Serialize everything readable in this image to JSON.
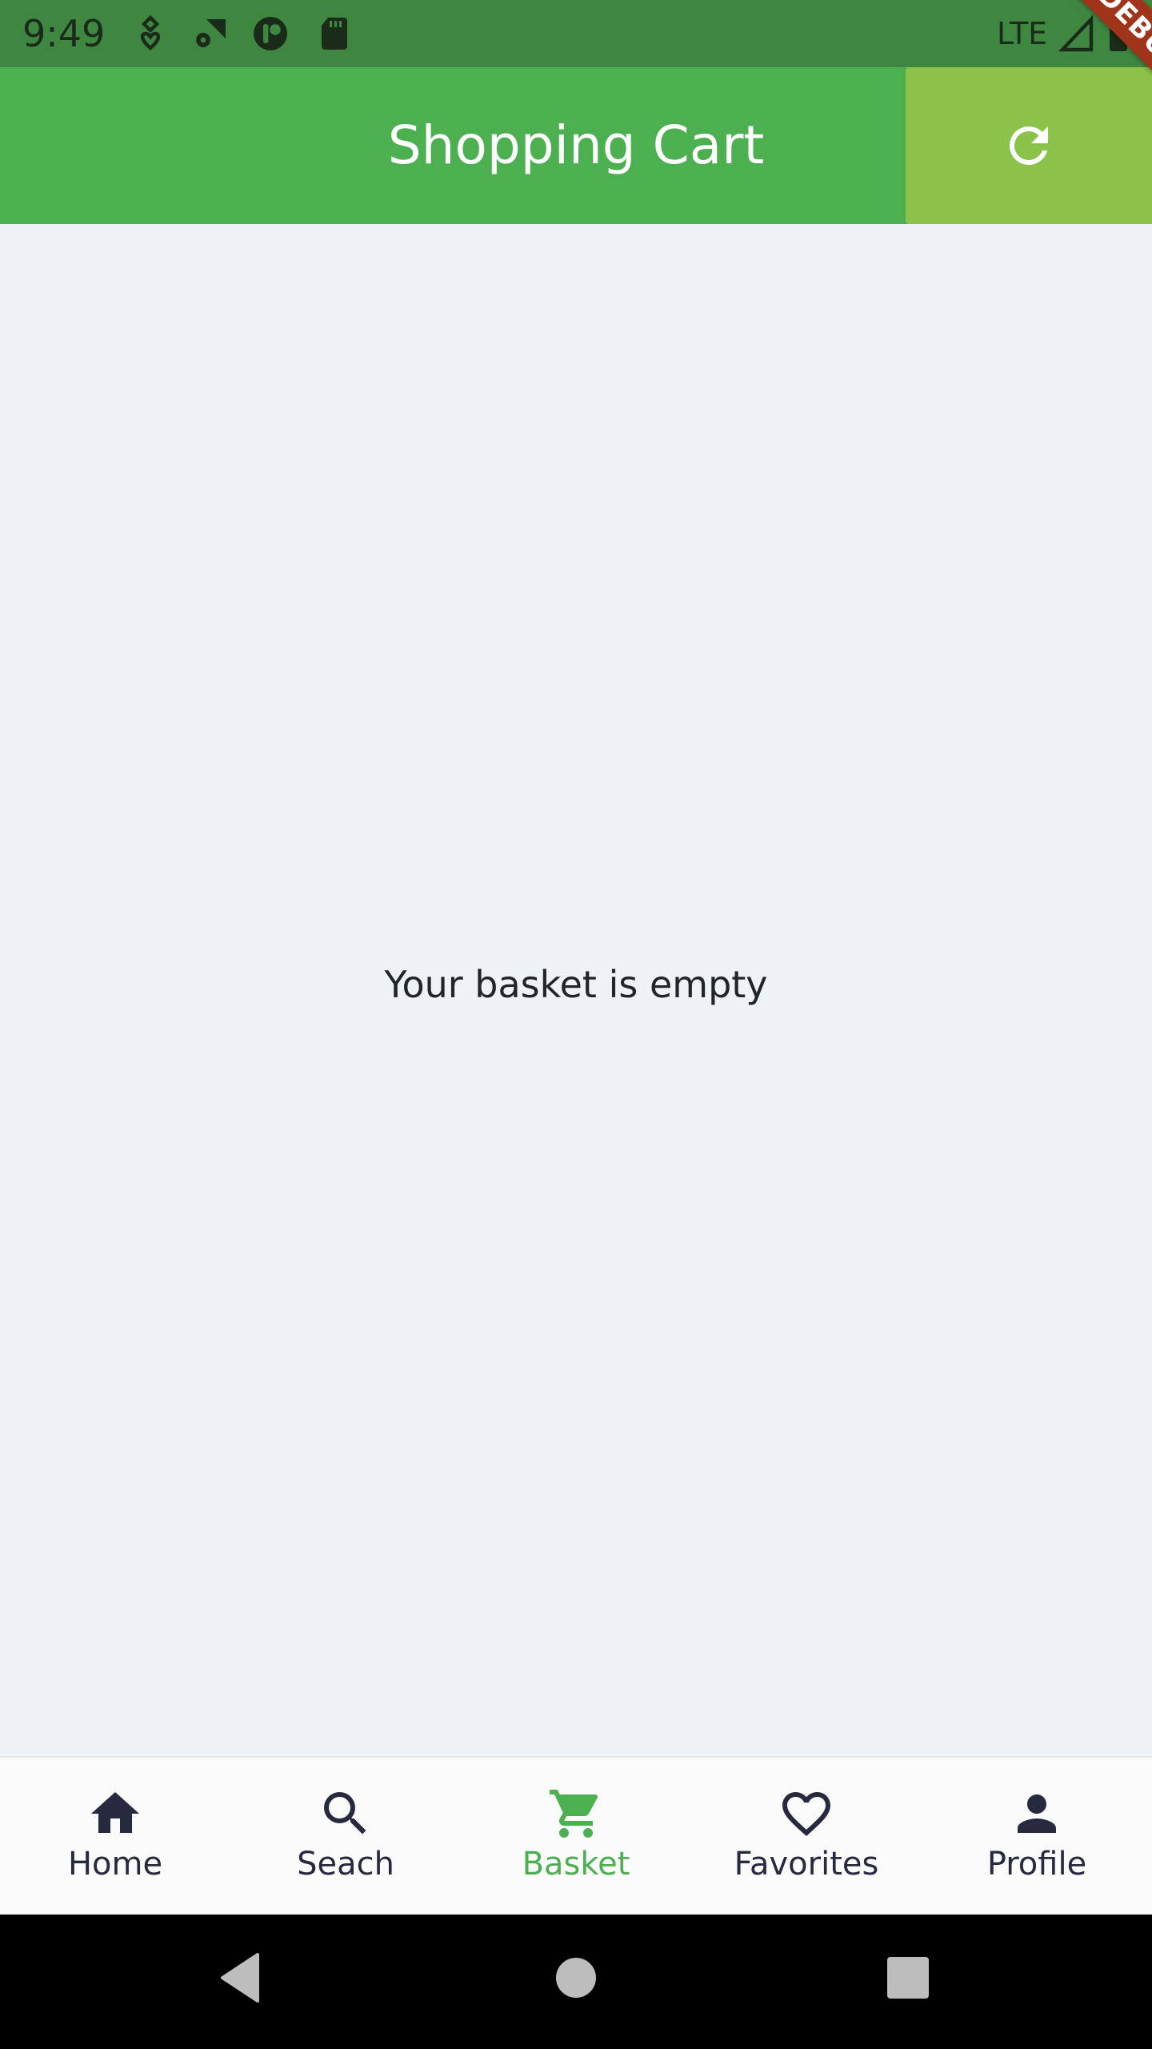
{
  "status_bar": {
    "time": "9:49",
    "network": "LTE",
    "icons": [
      "location-heart-icon",
      "wifi-settings-icon",
      "app-badge-icon",
      "sd-card-icon",
      "signal-icon",
      "battery-icon"
    ]
  },
  "debug_banner": {
    "label": "DEBUG",
    "color": "#A0341A"
  },
  "app_bar": {
    "title": "Shopping Cart",
    "background": "#4CAF50",
    "action": {
      "icon": "refresh-icon",
      "background": "#8BC34A"
    }
  },
  "content": {
    "empty_message": "Your basket is empty",
    "background": "#EDF2F5"
  },
  "bottom_nav": {
    "active_color": "#4CAF50",
    "inactive_color": "#272A3F",
    "items": [
      {
        "label": "Home",
        "icon": "home-icon",
        "active": false
      },
      {
        "label": "Seach",
        "icon": "search-icon",
        "active": false
      },
      {
        "label": "Basket",
        "icon": "cart-icon",
        "active": true
      },
      {
        "label": "Favorites",
        "icon": "heart-icon",
        "active": false
      },
      {
        "label": "Profile",
        "icon": "person-icon",
        "active": false
      }
    ]
  },
  "system_nav": {
    "buttons": [
      "back-icon",
      "home-circle-icon",
      "recents-icon"
    ]
  }
}
